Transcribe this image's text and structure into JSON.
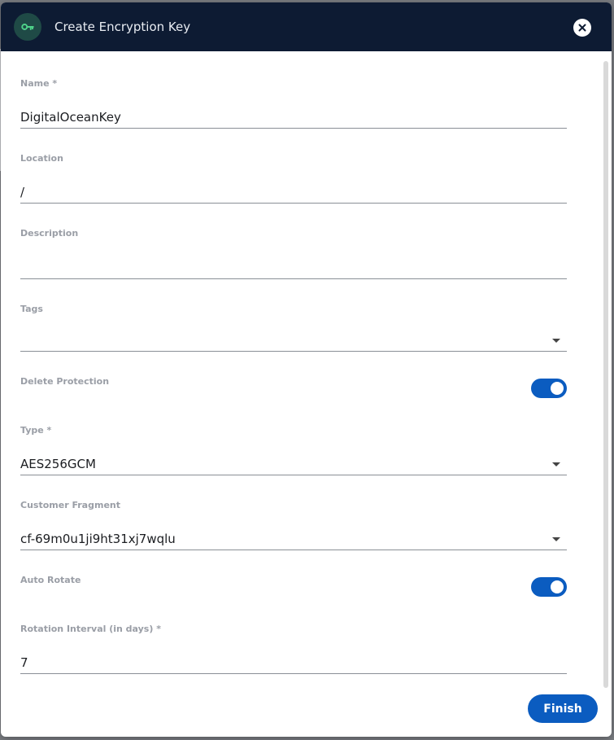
{
  "dialog": {
    "title": "Create Encryption Key",
    "header_icon": "key-icon",
    "close_icon": "close-icon"
  },
  "fields": {
    "name": {
      "label": "Name *",
      "value": "DigitalOceanKey"
    },
    "location": {
      "label": "Location",
      "value": "/"
    },
    "description": {
      "label": "Description",
      "value": ""
    },
    "tags": {
      "label": "Tags",
      "value": ""
    },
    "delete_protection": {
      "label": "Delete Protection",
      "enabled": true
    },
    "type": {
      "label": "Type *",
      "value": "AES256GCM"
    },
    "customer_fragment": {
      "label": "Customer Fragment",
      "value": "cf-69m0u1ji9ht31xj7wqlu"
    },
    "auto_rotate": {
      "label": "Auto Rotate",
      "enabled": true
    },
    "rotation_interval": {
      "label": "Rotation Interval (in days) *",
      "value": "7"
    }
  },
  "actions": {
    "finish_label": "Finish"
  },
  "colors": {
    "header_bg": "#0d1b33",
    "accent": "#0b5cc0",
    "icon_green": "#4fd38a"
  }
}
